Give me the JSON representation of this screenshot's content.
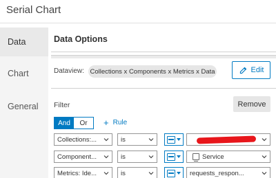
{
  "app": {
    "title": "Serial Chart"
  },
  "sidebar": {
    "items": [
      {
        "label": "Data",
        "active": true
      },
      {
        "label": "Chart",
        "active": false
      },
      {
        "label": "General",
        "active": false
      }
    ]
  },
  "data_options": {
    "title": "Data Options",
    "dataview_label": "Dataview:",
    "dataview_value": "Collections x Components x Metrics x Data",
    "edit_label": "Edit"
  },
  "filter": {
    "label": "Filter",
    "remove_label": "Remove",
    "toggle": {
      "and_label": "And",
      "or_label": "Or",
      "selected": "And"
    },
    "add_rule_label": "Rule",
    "rules": [
      {
        "field": "Collections:...",
        "operator": "is",
        "value": ""
      },
      {
        "field": "Component...",
        "operator": "is",
        "value": "Service"
      },
      {
        "field": "Metrics: Ide...",
        "operator": "is",
        "value": "requests_respon..."
      }
    ]
  },
  "colors": {
    "accent": "#007ac2",
    "redaction": "#e8161b",
    "sidebar_bg": "#f4f4f4",
    "pill_bg": "#e6e6e6"
  },
  "icons": {
    "edit": "pencil-icon",
    "add": "plus-icon",
    "chevron": "chevron-down-icon",
    "type": "field-type-icon",
    "service": "service-icon"
  }
}
